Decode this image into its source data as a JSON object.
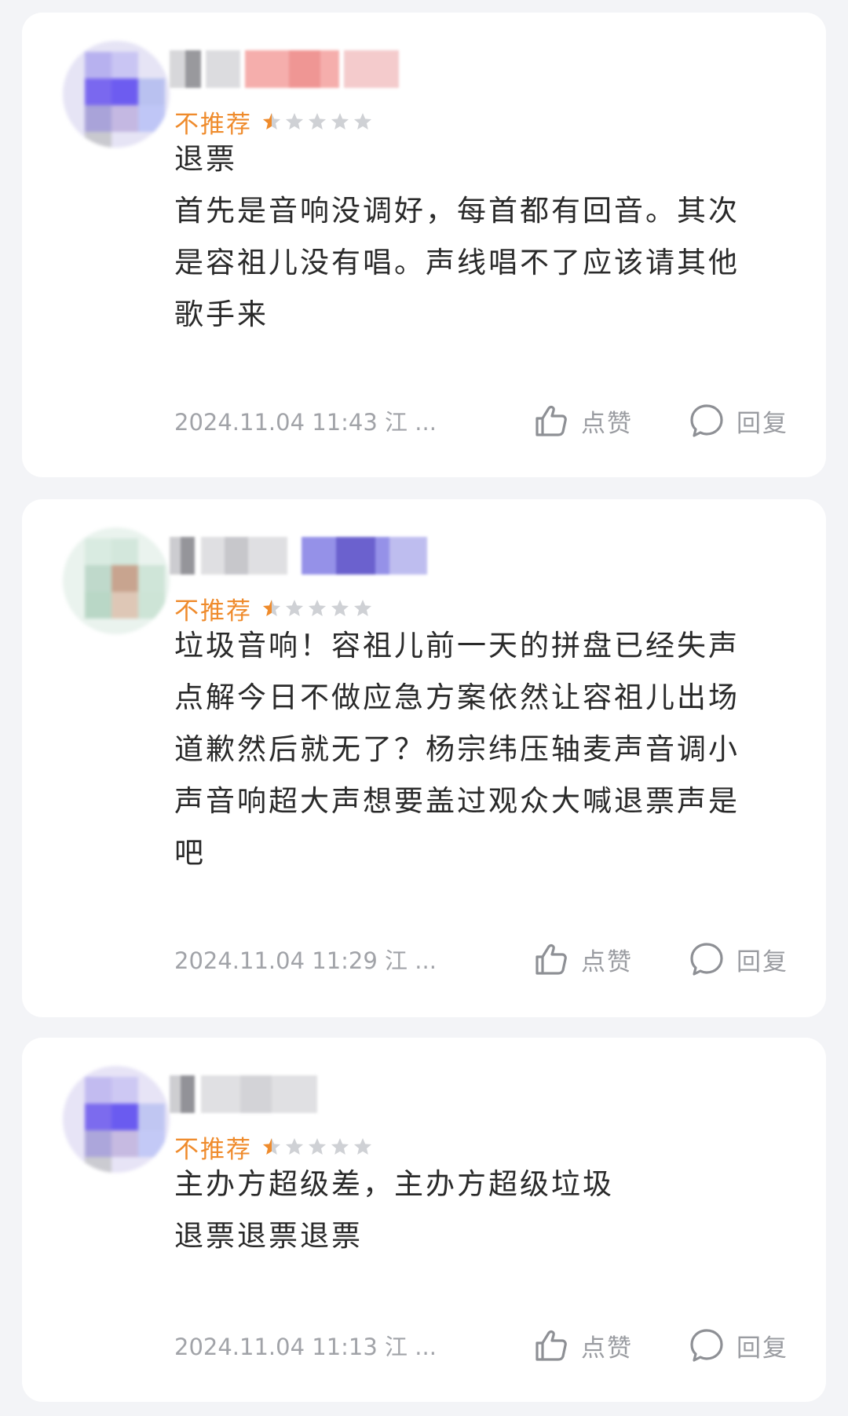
{
  "colors": {
    "recommend_label": "#ef8b2c",
    "star_filled": "#ef8b2c",
    "star_empty": "#cfd1d5",
    "meta_text": "#a1a3a8"
  },
  "reviews": [
    {
      "rating_label": "不推荐",
      "rating": 0.5,
      "rating_max": 5,
      "lines": [
        "退票",
        "首先是音响没调好，每首都有回音。其次",
        "是容祖儿没有唱。声线唱不了应该请其他",
        "歌手来"
      ],
      "meta": "2024.11.04 11:43 江 ...",
      "like_label": "点赞",
      "reply_label": "回复",
      "like_icon": "thumbs-up-icon",
      "reply_icon": "comment-bubble-icon"
    },
    {
      "rating_label": "不推荐",
      "rating": 0.5,
      "rating_max": 5,
      "lines": [
        "垃圾音响！容祖儿前一天的拼盘已经失声",
        "点解今日不做应急方案依然让容祖儿出场",
        "道歉然后就无了？杨宗纬压轴麦声音调小",
        "声音响超大声想要盖过观众大喊退票声是",
        "吧"
      ],
      "meta": "2024.11.04 11:29 江 ...",
      "like_label": "点赞",
      "reply_label": "回复",
      "like_icon": "thumbs-up-icon",
      "reply_icon": "comment-bubble-icon"
    },
    {
      "rating_label": "不推荐",
      "rating": 0.5,
      "rating_max": 5,
      "lines": [
        "主办方超级差，主办方超级垃圾",
        "退票退票退票"
      ],
      "meta": "2024.11.04 11:13 江 ...",
      "like_label": "点赞",
      "reply_label": "回复",
      "like_icon": "thumbs-up-icon",
      "reply_icon": "comment-bubble-icon"
    }
  ]
}
